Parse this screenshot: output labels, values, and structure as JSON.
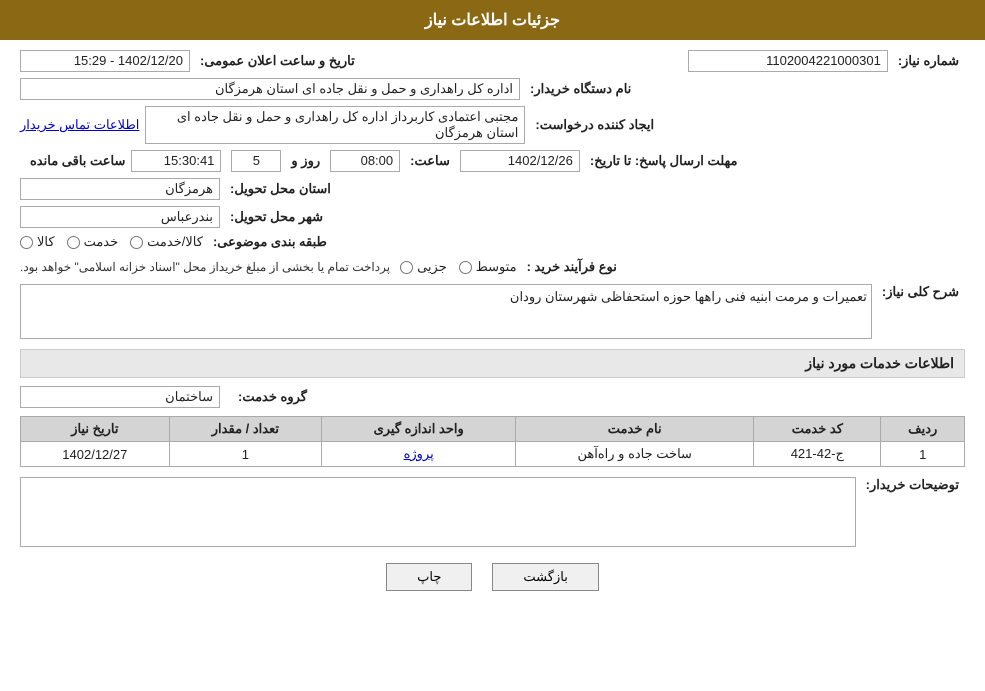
{
  "header": {
    "title": "جزئیات اطلاعات نیاز"
  },
  "form": {
    "need_number_label": "شماره نیاز:",
    "need_number_value": "1102004221000301",
    "announce_date_label": "تاریخ و ساعت اعلان عمومی:",
    "announce_date_value": "1402/12/20 - 15:29",
    "buyer_org_label": "نام دستگاه خریدار:",
    "buyer_org_value": "اداره کل راهداری و حمل و نقل جاده ای استان هرمزگان",
    "creator_label": "ایجاد کننده درخواست:",
    "creator_value": "مجتبی اعتمادی کاربرداز اداره کل راهداری و حمل و نقل جاده ای استان هرمزگان",
    "contact_link": "اطلاعات تماس خریدار",
    "deadline_label": "مهلت ارسال پاسخ: تا تاریخ:",
    "deadline_date": "1402/12/26",
    "deadline_time_label": "ساعت:",
    "deadline_time": "08:00",
    "deadline_days_label": "روز و",
    "deadline_days": "5",
    "deadline_remaining_label": "ساعت باقی مانده",
    "deadline_remaining": "15:30:41",
    "province_label": "استان محل تحویل:",
    "province_value": "هرمزگان",
    "city_label": "شهر محل تحویل:",
    "city_value": "بندرعباس",
    "category_label": "طبقه بندی موضوعی:",
    "category_options": [
      {
        "label": "کالا",
        "checked": false
      },
      {
        "label": "خدمت",
        "checked": false
      },
      {
        "label": "کالا/خدمت",
        "checked": false
      }
    ],
    "purchase_type_label": "نوع فرآیند خرید :",
    "purchase_type_options": [
      {
        "label": "جزیی",
        "checked": false
      },
      {
        "label": "متوسط",
        "checked": false
      }
    ],
    "purchase_note": "پرداخت تمام یا بخشی از مبلغ خریداز محل \"اسناد خزانه اسلامی\" خواهد بود.",
    "need_description_label": "شرح کلی نیاز:",
    "need_description": "تعمیرات  و  مرمت ابنیه فنی راهها حوزه استحفاظی شهرستان رودان",
    "services_title": "اطلاعات خدمات مورد نیاز",
    "service_group_label": "گروه خدمت:",
    "service_group_value": "ساختمان",
    "table": {
      "columns": [
        "ردیف",
        "کد خدمت",
        "نام خدمت",
        "واحد اندازه گیری",
        "تعداد / مقدار",
        "تاریخ نیاز"
      ],
      "rows": [
        {
          "row": "1",
          "service_code": "ج-42-421",
          "service_name": "ساخت جاده و راه‌آهن",
          "unit": "پروژه",
          "quantity": "1",
          "date": "1402/12/27"
        }
      ]
    },
    "buyer_desc_label": "توضیحات خریدار:",
    "buyer_desc_value": "",
    "btn_print": "چاپ",
    "btn_back": "بازگشت"
  }
}
